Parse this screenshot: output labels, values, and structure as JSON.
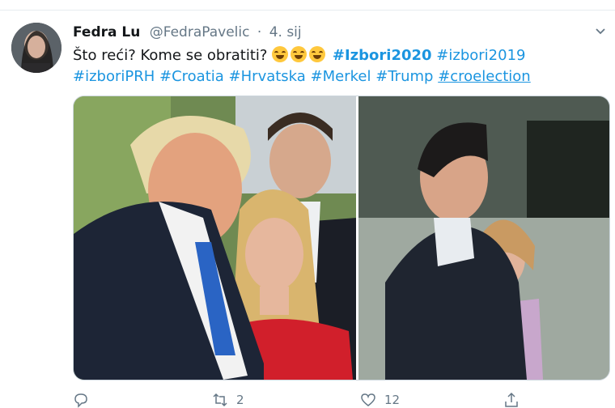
{
  "tweet": {
    "author_name": "Fedra Lu",
    "author_handle": "@FedraPavelic",
    "date": "4. sij",
    "separator": "·",
    "text_intro": "Što reći? Kome se obratiti?",
    "hashtags": [
      "#Izbori2020",
      "#izbori2019",
      "#izboriPRH",
      "#Croatia",
      "#Hrvatska",
      "#Merkel",
      "#Trump",
      "#croelection"
    ],
    "actions": {
      "reply_count": "",
      "retweet_count": "2",
      "like_count": "12",
      "share_count": ""
    }
  },
  "icons": {
    "more": "chevron-down-icon",
    "reply": "reply-icon",
    "retweet": "retweet-icon",
    "like": "heart-icon",
    "share": "share-icon",
    "emoji": "tears-of-joy-emoji"
  },
  "colors": {
    "link": "#1b95e0",
    "text": "#14171a",
    "muted": "#657786"
  }
}
